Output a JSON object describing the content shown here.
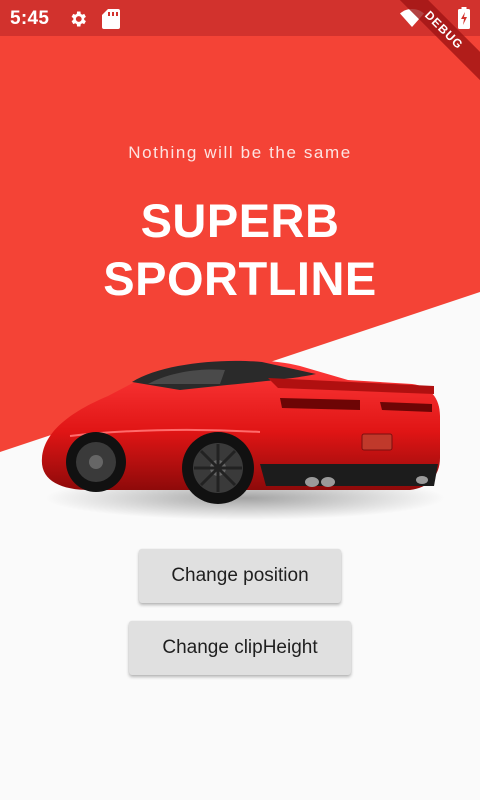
{
  "status_bar": {
    "time": "5:45",
    "icons": [
      "gear-icon",
      "sd-card-icon",
      "wifi-icon",
      "battery-charging-icon"
    ]
  },
  "debug_banner": "DEBUG",
  "hero": {
    "tagline": "Nothing will be the same",
    "headline_line1": "SUPERB",
    "headline_line2": "SPORTLINE",
    "car_image": "red-sports-car"
  },
  "buttons": {
    "change_position": "Change position",
    "change_clip_height": "Change clipHeight"
  },
  "colors": {
    "hero_red": "#f44336",
    "status_bar": "#d2322d",
    "background": "#fafafa",
    "button_bg": "#e0e0e0"
  }
}
